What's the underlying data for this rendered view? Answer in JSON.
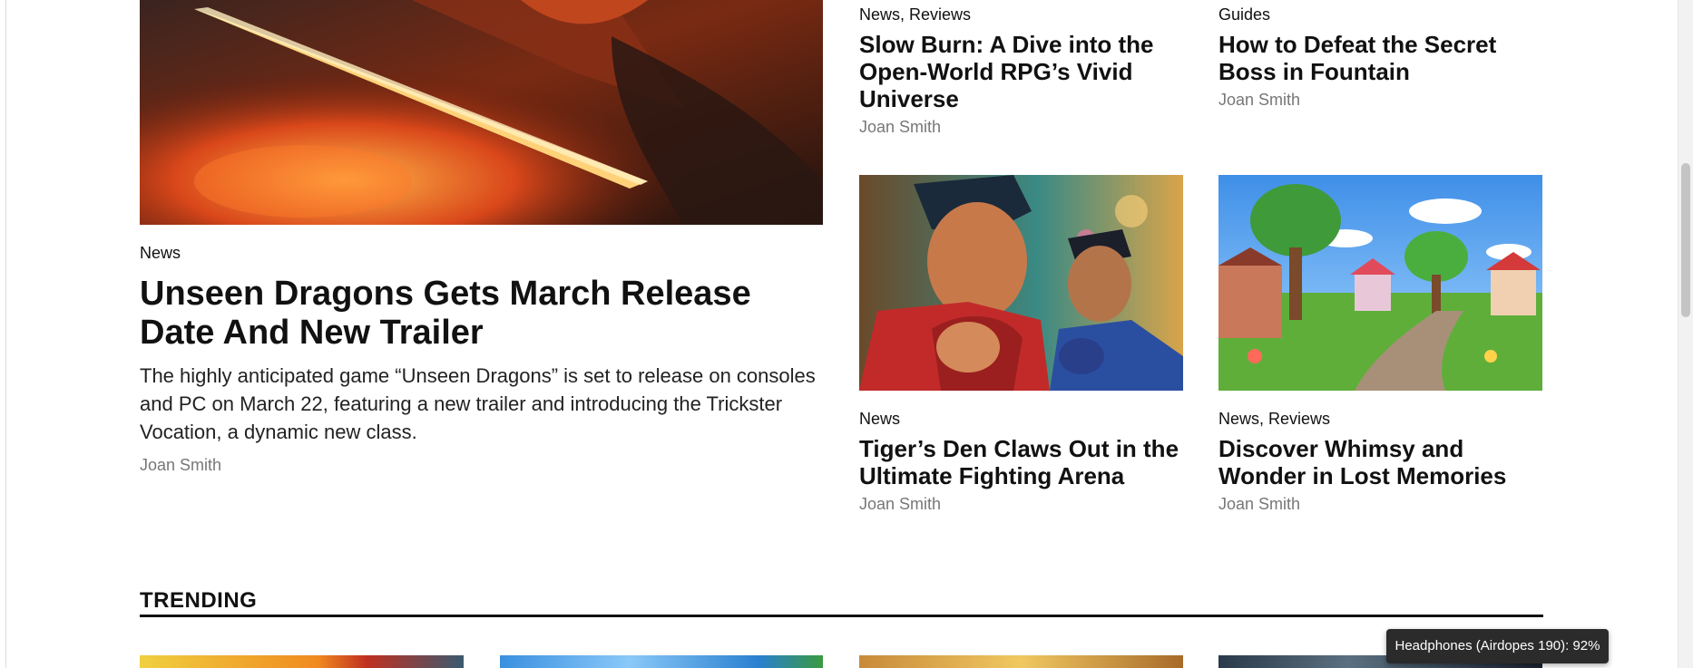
{
  "featured": {
    "category": "News",
    "title": "Unseen Dragons Gets March Release Date And New Trailer",
    "excerpt": "The highly anticipated game “Unseen Dragons” is set to release on consoles and PC on March 22, featuring a new trailer and introducing the Trickster Vocation, a dynamic new class.",
    "author": "Joan Smith"
  },
  "cards": [
    {
      "category": "News, Reviews",
      "title": "Slow Burn: A Dive into the Open-World RPG’s Vivid Universe",
      "author": "Joan Smith"
    },
    {
      "category": "Guides",
      "title": "How to Defeat the Secret Boss in Fountain",
      "author": "Joan Smith"
    },
    {
      "category": "News",
      "title": "Tiger’s Den Claws Out in the Ultimate Fighting Arena",
      "author": "Joan Smith"
    },
    {
      "category": "News, Reviews",
      "title": "Discover Whimsy and Wonder in Lost Memories",
      "author": "Joan Smith"
    }
  ],
  "trending": {
    "heading": "TRENDING"
  },
  "toast": {
    "text": "Headphones (Airdopes 190): 92%"
  }
}
